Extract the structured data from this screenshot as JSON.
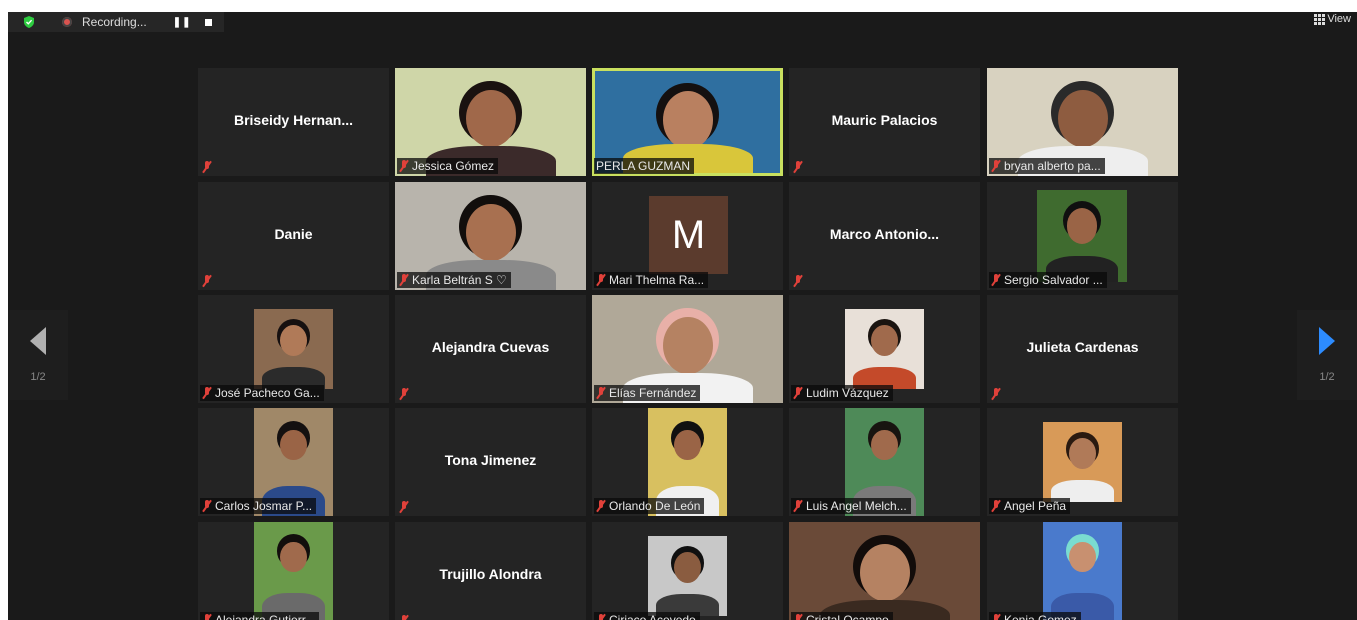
{
  "toolbar": {
    "recording_label": "Recording...",
    "pause_glyph": "❚❚",
    "view_label": "View"
  },
  "nav": {
    "left_page": "1/2",
    "right_page": "1/2"
  },
  "icons": {
    "security": "shield-check-icon",
    "recording": "record-dot-icon",
    "muted": "mic-muted-icon",
    "view": "grid-view-icon",
    "prev": "arrow-left-icon",
    "next": "arrow-right-icon"
  },
  "colors": {
    "active_speaker_border": "#c9e05f",
    "muted_icon": "#e0413a",
    "next_arrow": "#2d8cff",
    "avatar_bg": "#5b3b2d"
  },
  "participants": [
    {
      "display": "Briseidy  Hernan...",
      "label": "",
      "video": false
    },
    {
      "display": "",
      "label": "Jessica Gómez",
      "video": true
    },
    {
      "display": "",
      "label": "PERLA GUZMAN",
      "video": true,
      "active": true
    },
    {
      "display": "Mauric Palacios",
      "label": "",
      "video": false
    },
    {
      "display": "",
      "label": "bryan alberto pa...",
      "video": true
    },
    {
      "display": "Danie",
      "label": "",
      "video": false
    },
    {
      "display": "",
      "label": "Karla Beltrán S ♡",
      "video": true
    },
    {
      "display": "M",
      "label": "Mari Thelma Ra...",
      "video": false,
      "avatar": true
    },
    {
      "display": "Marco  Antonio...",
      "label": "",
      "video": false
    },
    {
      "display": "",
      "label": "Sergio Salvador ...",
      "video": true
    },
    {
      "display": "",
      "label": "José Pacheco Ga...",
      "video": true
    },
    {
      "display": "Alejandra Cuevas",
      "label": "",
      "video": false
    },
    {
      "display": "",
      "label": "Elías Fernández",
      "video": true
    },
    {
      "display": "",
      "label": "Ludim Vázquez",
      "video": true
    },
    {
      "display": "Julieta Cardenas",
      "label": "",
      "video": false
    },
    {
      "display": "",
      "label": "Carlos Josmar P...",
      "video": true
    },
    {
      "display": "Tona Jimenez",
      "label": "",
      "video": false
    },
    {
      "display": "",
      "label": "Orlando De León",
      "video": true
    },
    {
      "display": "",
      "label": "Luis Angel Melch...",
      "video": true
    },
    {
      "display": "",
      "label": "Angel Peña",
      "video": true
    },
    {
      "display": "",
      "label": "Alejandra Gutierr...",
      "video": true
    },
    {
      "display": "Trujillo Alondra",
      "label": "",
      "video": false
    },
    {
      "display": "",
      "label": "Ciriaco Acevedo",
      "video": true
    },
    {
      "display": "",
      "label": "Cristal Ocampo",
      "video": true
    },
    {
      "display": "",
      "label": "Kenia Gomez",
      "video": true
    }
  ]
}
